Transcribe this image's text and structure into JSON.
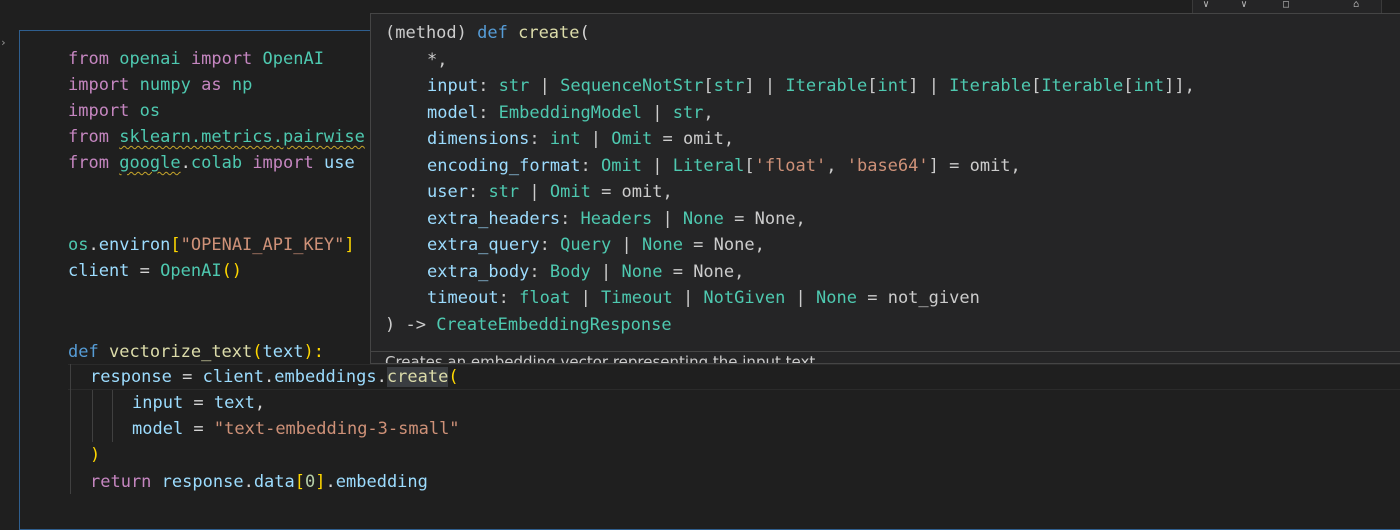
{
  "code": {
    "line1": {
      "kw": "from",
      "mod": "openai",
      "imp": "import",
      "cls": "OpenAI"
    },
    "line2": {
      "kw": "import",
      "mod": "numpy",
      "as": "as",
      "alias": "np"
    },
    "line3": {
      "kw": "import",
      "mod": "os"
    },
    "line4": {
      "kw": "from",
      "mod": "sklearn.metrics.pairwise"
    },
    "line5": {
      "kw": "from",
      "mod1": "google",
      "dot": ".",
      "mod2": "colab",
      "imp": "import",
      "rest": "use"
    },
    "line8": {
      "obj": "os",
      "dot": ".",
      "attr": "environ",
      "lb": "[",
      "str": "\"OPENAI_API_KEY\"",
      "rb": "]"
    },
    "line9": {
      "var": "client",
      "eq": " = ",
      "cls": "OpenAI",
      "parens": "()"
    },
    "line12": {
      "def": "def",
      "fn": "vectorize_text",
      "lp": "(",
      "param": "text",
      "rp": "):"
    },
    "line13": {
      "var": "response",
      "eq": " = ",
      "obj": "client",
      "dot1": ".",
      "attr": "embeddings",
      "dot2": ".",
      "method": "create",
      "lp": "("
    },
    "line14": {
      "param": "input",
      "eq": " = ",
      "val": "text",
      "comma": ","
    },
    "line15": {
      "param": "model",
      "eq": " = ",
      "val": "\"text-embedding-3-small\""
    },
    "line16": {
      "rp": ")"
    },
    "line17": {
      "ret": "return",
      "obj": "response",
      "dot1": ".",
      "attr": "data",
      "lb": "[",
      "idx": "0",
      "rb": "]",
      "dot2": ".",
      "attr2": "embedding"
    }
  },
  "hover": {
    "header": {
      "prefix": "(method) ",
      "def": "def",
      "name": "create",
      "lp": "("
    },
    "params": {
      "star": "*,",
      "input": {
        "name": "input",
        "colon": ": ",
        "t1": "str",
        "bar": " | ",
        "t2": "SequenceNotStr",
        "lb": "[",
        "t2a": "str",
        "rb": "]",
        "t3": "Iterable",
        "t3a": "int",
        "t4": "Iterable",
        "t4a": "Iterable",
        "t4b": "int",
        "end": "]],"
      },
      "model": {
        "name": "model",
        "colon": ": ",
        "t1": "EmbeddingModel",
        "bar": " | ",
        "t2": "str",
        "end": ","
      },
      "dimensions": {
        "name": "dimensions",
        "colon": ": ",
        "t1": "int",
        "bar": " | ",
        "t2": "Omit",
        "eq": " = ",
        "def": "omit",
        "end": ","
      },
      "encoding_format": {
        "name": "encoding_format",
        "colon": ": ",
        "t1": "Omit",
        "bar": " | ",
        "t2": "Literal",
        "lb": "[",
        "s1": "'float'",
        "sep": ", ",
        "s2": "'base64'",
        "rb": "]",
        "eq": " = ",
        "def": "omit",
        "end": ","
      },
      "user": {
        "name": "user",
        "colon": ": ",
        "t1": "str",
        "bar": " | ",
        "t2": "Omit",
        "eq": " = ",
        "def": "omit",
        "end": ","
      },
      "extra_headers": {
        "name": "extra_headers",
        "colon": ": ",
        "t1": "Headers",
        "bar": " | ",
        "t2": "None",
        "eq": " = ",
        "def": "None",
        "end": ","
      },
      "extra_query": {
        "name": "extra_query",
        "colon": ": ",
        "t1": "Query",
        "bar": " | ",
        "t2": "None",
        "eq": " = ",
        "def": "None",
        "end": ","
      },
      "extra_body": {
        "name": "extra_body",
        "colon": ": ",
        "t1": "Body",
        "bar": " | ",
        "t2": "None",
        "eq": " = ",
        "def": "None",
        "end": ","
      },
      "timeout": {
        "name": "timeout",
        "colon": ": ",
        "t1": "float",
        "bar": " | ",
        "t2": "Timeout",
        "t3": "NotGiven",
        "t4": "None",
        "eq": " = ",
        "def": "not_given"
      }
    },
    "footer": {
      "close": ") -> ",
      "ret": "CreateEmbeddingResponse"
    },
    "doc": "Creates an embedding vector representing the input text."
  },
  "icons": [
    "chevron-right-icon",
    "split-icon",
    "more-icon",
    "toggle-icon",
    "delete-icon"
  ]
}
